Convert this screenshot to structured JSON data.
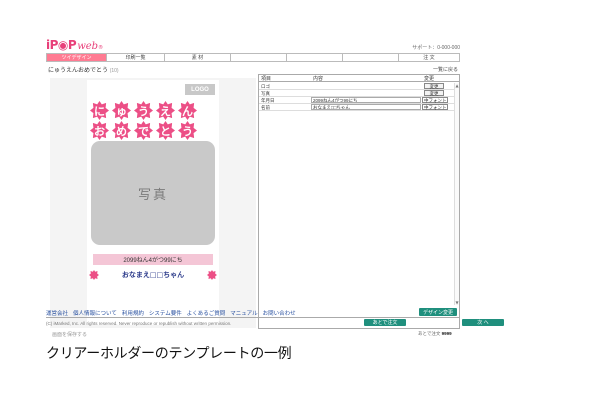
{
  "header": {
    "logo_main": "iP◉P",
    "logo_sub": "web",
    "logo_reg": "®",
    "phone": "サポート：0-000-000"
  },
  "tabs": [
    {
      "label": "ツイデザイン",
      "active": true
    },
    {
      "label": "印刷一覧",
      "active": false
    },
    {
      "label": "素 材",
      "active": false
    },
    {
      "label": "",
      "active": false
    },
    {
      "label": "",
      "active": false
    },
    {
      "label": "",
      "active": false
    },
    {
      "label": "注 文",
      "active": false
    }
  ],
  "breadcrumb": {
    "title": "にゅうえんおめでとう",
    "count": "(10)"
  },
  "back_link": "一覧に戻る",
  "preview": {
    "logo_placeholder": "LOGO",
    "row1": [
      "に",
      "ゅ",
      "う",
      "え",
      "ん"
    ],
    "row2": [
      "お",
      "め",
      "で",
      "と",
      "う"
    ],
    "photo_label": "写真",
    "ribbon_text": "2099ねん4がつ99にち",
    "name_text": "おなまえ□□ちゃん"
  },
  "download_link": "画面を保存する",
  "editor": {
    "headers": {
      "item": "項目",
      "content": "内容",
      "change": "変更"
    },
    "rows": [
      {
        "key": "ロゴ",
        "value": "",
        "control": "button",
        "control_label": "変更"
      },
      {
        "key": "写真",
        "value": "",
        "control": "button",
        "control_label": "変更"
      },
      {
        "key": "年月日",
        "value": "2099ねん4がつ99にち",
        "control": "select",
        "control_label": "中フォント"
      },
      {
        "key": "名前",
        "value": "おなまえ□□ちゃん",
        "control": "select",
        "control_label": "中フォント"
      }
    ],
    "apply_button": "デザイン変更",
    "later_button": "あとで注文",
    "next_button": "次 へ",
    "qty_label": "あとで注文",
    "qty_value": "9999"
  },
  "footer": {
    "links": [
      "運営会社",
      "個人情報について",
      "利用規約",
      "システム要件",
      "よくあるご質問",
      "マニュアル",
      "お問い合わせ"
    ],
    "copyright": "(C) iMarked, Inc. All rights reserved. Never reproduce or republish without written permission."
  },
  "caption": "クリアーホルダーのテンプレートの一例",
  "colors": {
    "accent": "#ff7b92",
    "flower": "#ec4f86",
    "button": "#1f8f7d",
    "link": "#2850a0"
  }
}
